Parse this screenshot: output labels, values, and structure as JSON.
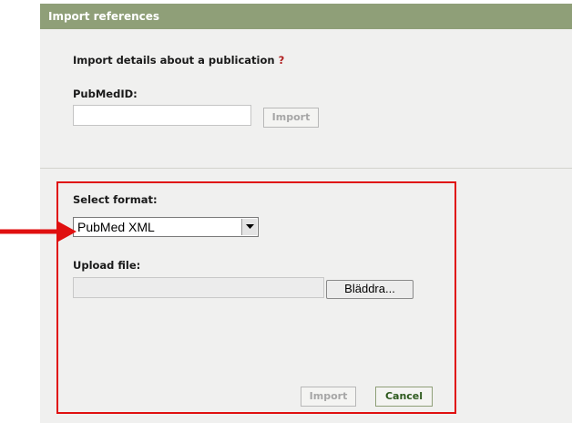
{
  "dialog": {
    "title": "Import references"
  },
  "pubmed_section": {
    "heading": "Import details about a publication",
    "help_mark": "?",
    "pubmed_label": "PubMedID:",
    "pubmed_value": "",
    "import_button": "Import"
  },
  "file_section": {
    "format_label": "Select format:",
    "format_selected": "PubMed XML",
    "upload_label": "Upload file:",
    "browse_button": "Bläddra...",
    "import_button": "Import",
    "cancel_button": "Cancel"
  },
  "colors": {
    "header_bg": "#8f9f78",
    "panel_bg": "#f0f0ef",
    "annotation_red": "#e01010"
  }
}
